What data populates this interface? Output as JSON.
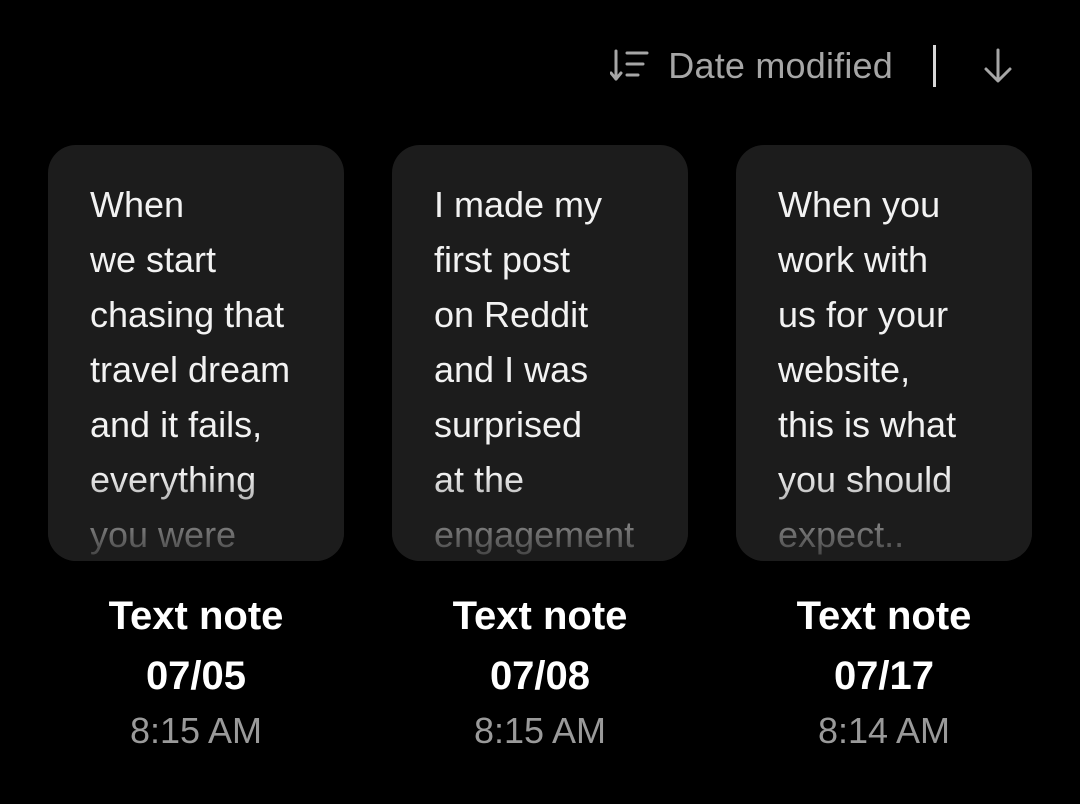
{
  "sort": {
    "label": "Date modified",
    "icon": "sort-icon",
    "direction_icon": "arrow-down-icon"
  },
  "colors": {
    "background": "#000000",
    "card": "#1c1c1c",
    "text": "#ffffff",
    "muted": "#9a9a9a"
  },
  "notes": [
    {
      "preview": "When\nwe start\nchasing that\ntravel dream\nand it fails,\neverything\nyou were",
      "title": "Text note",
      "date": "07/05",
      "time": "8:15 AM"
    },
    {
      "preview": "I made my\nfirst post\non Reddit\nand I was\nsurprised\nat the\nengagement",
      "title": "Text note",
      "date": "07/08",
      "time": "8:15 AM"
    },
    {
      "preview": "When you\nwork with\nus for your\nwebsite,\nthis is what\nyou should\nexpect..",
      "title": "Text note",
      "date": "07/17",
      "time": "8:14 AM"
    }
  ]
}
